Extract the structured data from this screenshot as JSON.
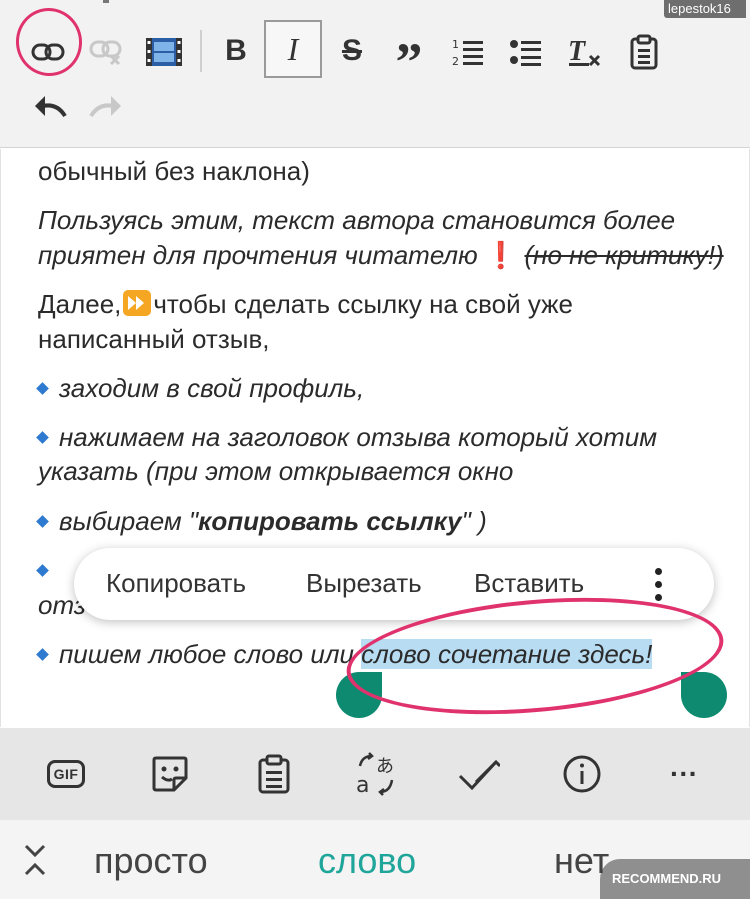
{
  "status_bar": {
    "username": "lepestok16"
  },
  "toolbar": {
    "buttons": [
      {
        "name": "link",
        "enabled": true
      },
      {
        "name": "unlink",
        "enabled": false
      },
      {
        "name": "video",
        "enabled": true
      },
      {
        "name": "bold",
        "label": "B"
      },
      {
        "name": "italic",
        "label": "I",
        "active": true
      },
      {
        "name": "strikethrough",
        "label": "S"
      },
      {
        "name": "quote",
        "label": "”"
      },
      {
        "name": "numbered-list"
      },
      {
        "name": "bulleted-list"
      },
      {
        "name": "clear-format"
      },
      {
        "name": "paste"
      },
      {
        "name": "undo",
        "enabled": true
      },
      {
        "name": "redo",
        "enabled": false
      }
    ]
  },
  "editor": {
    "line1": "обычный без наклона)",
    "para2_line1": "Пользуясь этим, текст автора становится более",
    "para2_line2_a": "приятен для прочтения читателю ",
    "para2_excl": "❗",
    "para2_line2_strike": "(но не критику!)",
    "para3_line1_a": "Далее,",
    "para3_line1_b": "чтобы сделать ссылку на свой уже",
    "para3_line2": "написанный отзыв,",
    "bullet1": "заходим в свой профиль,",
    "bullet2_line1": "нажимаем на заголовок отзыва который хотим",
    "bullet2_line2": "указать (при этом открывается окно",
    "bullet3_a": "выбираем \"",
    "bullet3_bold": "копировать ссылку",
    "bullet3_b": "\" )",
    "bullet4_partial": "отз",
    "bullet5_a": "пишем любое слово или",
    "bullet5_selected": "слово сочетание здесь!"
  },
  "context_menu": {
    "copy": "Копировать",
    "cut": "Вырезать",
    "paste": "Вставить"
  },
  "keyboard_toolbar": {
    "gif_label": "GIF",
    "more_label": "···"
  },
  "suggestions": [
    "просто",
    "слово",
    "нет"
  ],
  "watermark": "RECOMMEND.RU",
  "colors": {
    "annotation_circle": "#e0336d",
    "selection": "#b8dcf2",
    "handle": "#0d8a6f",
    "suggestion_highlight": "#1fa59a"
  }
}
